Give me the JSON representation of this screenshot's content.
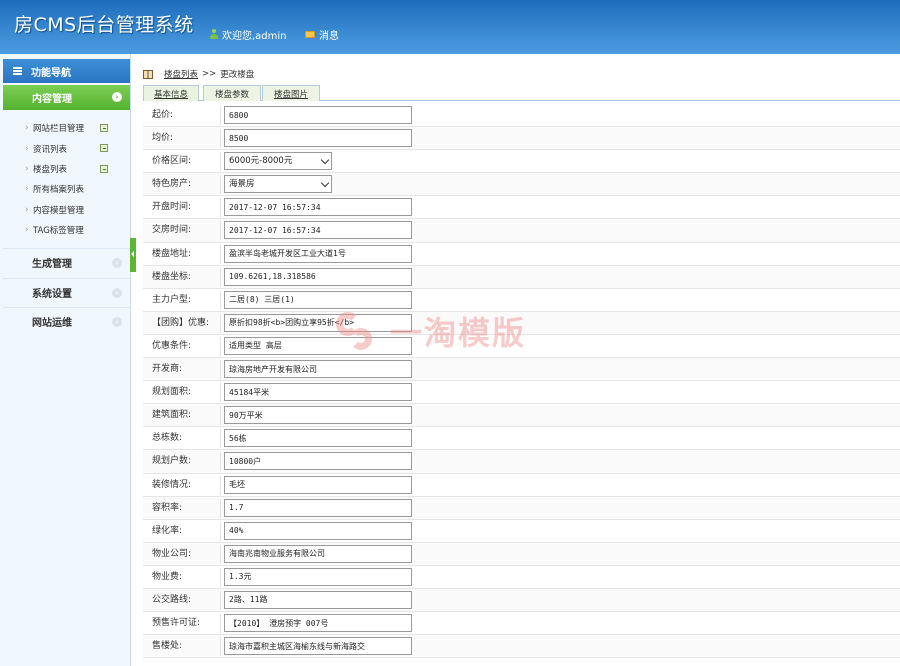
{
  "header": {
    "title": "房CMS后台管理系统",
    "welcome": "欢迎您,admin",
    "messages": "消息"
  },
  "sidebar": {
    "nav_title": "功能导航",
    "active_category": "内容管理",
    "items": [
      {
        "label": "网站栏目管理",
        "add": true
      },
      {
        "label": "资讯列表",
        "add": true
      },
      {
        "label": "楼盘列表",
        "add": true
      },
      {
        "label": "所有档案列表",
        "add": false
      },
      {
        "label": "内容模型管理",
        "add": false
      },
      {
        "label": "TAG标签管理",
        "add": false
      }
    ],
    "categories": [
      "生成管理",
      "系统设置",
      "网站运维"
    ]
  },
  "breadcrumb": {
    "link": "楼盘列表",
    "separator": ">>",
    "current": "更改楼盘"
  },
  "tabs": [
    "基本信息",
    "楼盘参数",
    "楼盘图片"
  ],
  "form": {
    "fields": [
      {
        "label": "起价:",
        "value": "6800",
        "type": "input"
      },
      {
        "label": "均价:",
        "value": "8500",
        "type": "input"
      },
      {
        "label": "价格区间:",
        "value": "6000元-8000元",
        "type": "select"
      },
      {
        "label": "特色房产:",
        "value": "海景房",
        "type": "select"
      },
      {
        "label": "开盘时间:",
        "value": "2017-12-07 16:57:34",
        "type": "input"
      },
      {
        "label": "交房时间:",
        "value": "2017-12-07 16:57:34",
        "type": "input"
      },
      {
        "label": "楼盘地址:",
        "value": "盈滨半岛老城开发区工业大道1号",
        "type": "input"
      },
      {
        "label": "楼盘坐标:",
        "value": "109.6261,18.318586",
        "type": "input"
      },
      {
        "label": "主力户型:",
        "value": "二居(8) 三居(1)",
        "type": "input"
      },
      {
        "label": "【团购】优惠:",
        "value": "原折扣98折<b>团购立享95折</b>",
        "type": "input"
      },
      {
        "label": "优惠条件:",
        "value": "适用类型 高层",
        "type": "input"
      },
      {
        "label": "开发商:",
        "value": "琼海房地产开发有限公司",
        "type": "input"
      },
      {
        "label": "规划面积:",
        "value": "45184平米",
        "type": "input"
      },
      {
        "label": "建筑面积:",
        "value": "90万平米",
        "type": "input"
      },
      {
        "label": "总栋数:",
        "value": "56栋",
        "type": "input"
      },
      {
        "label": "规划户数:",
        "value": "10800户",
        "type": "input"
      },
      {
        "label": "装修情况:",
        "value": "毛坯",
        "type": "input"
      },
      {
        "label": "容积率:",
        "value": "1.7",
        "type": "input"
      },
      {
        "label": "绿化率:",
        "value": "40%",
        "type": "input"
      },
      {
        "label": "物业公司:",
        "value": "海南兆南物业服务有限公司",
        "type": "input"
      },
      {
        "label": "物业费:",
        "value": "1.3元",
        "type": "input"
      },
      {
        "label": "公交路线:",
        "value": "2路、11路",
        "type": "input"
      },
      {
        "label": "预售许可证:",
        "value": "【2010】 澄房预字 007号",
        "type": "input"
      },
      {
        "label": "售楼处:",
        "value": "琼海市嘉积主城区海榆东线与新海路交",
        "type": "input"
      }
    ]
  },
  "watermark": "一淘模版",
  "colors": {
    "header": "#2f7fcf",
    "nav_active": "#5cb636",
    "accent_text": "#ffffff"
  }
}
